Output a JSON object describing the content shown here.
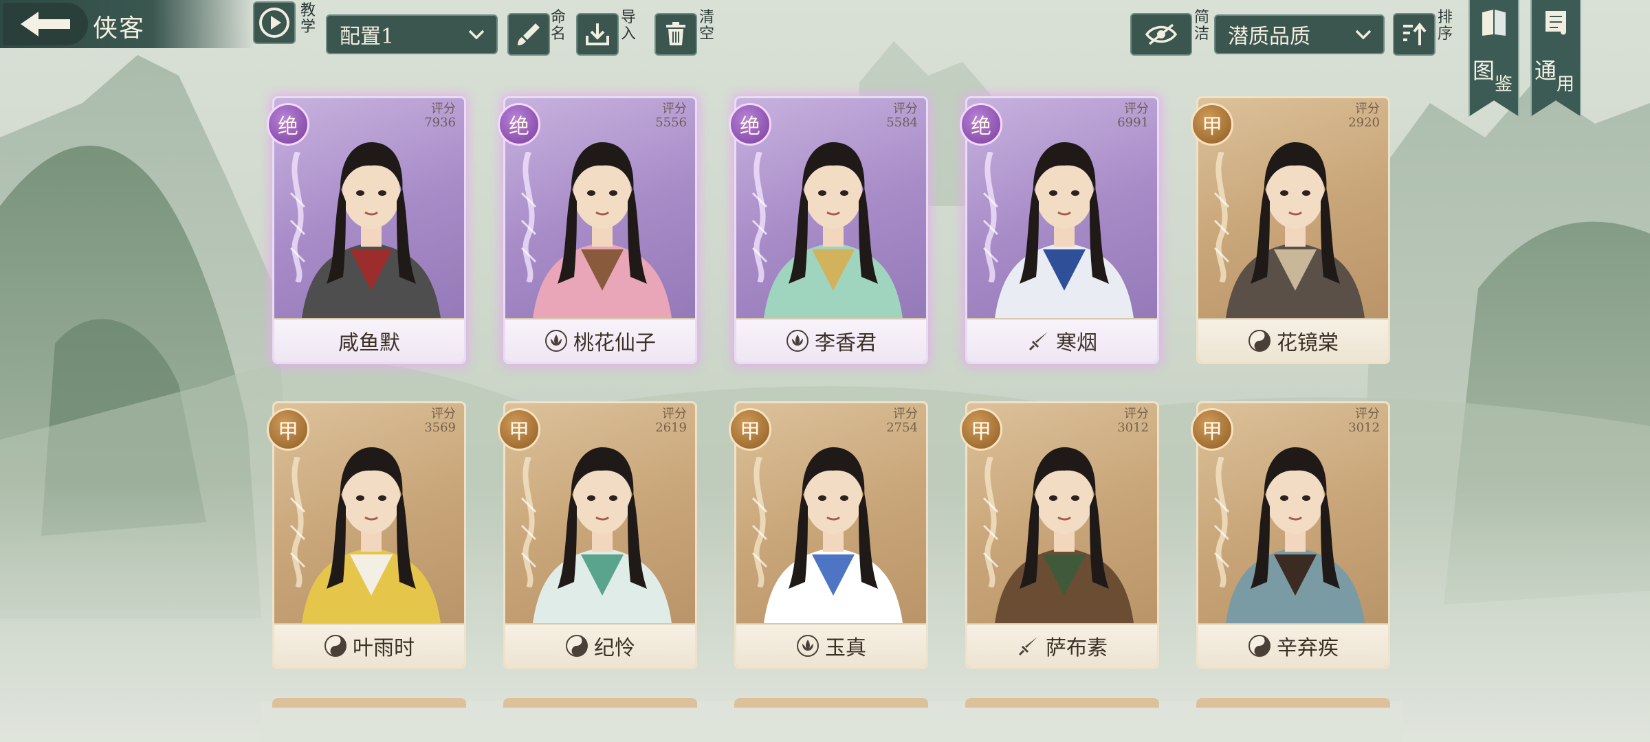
{
  "header": {
    "title": "侠客",
    "tutorial_label": "教学",
    "config_select": "配置1",
    "rename_label": "命名",
    "import_label": "导入",
    "clear_label": "清空",
    "simple_label": "简洁",
    "filter_select": "潜质品质",
    "sort_label": "排序"
  },
  "side_tabs": [
    {
      "label_1": "图",
      "label_2": "鉴"
    },
    {
      "label_1": "通",
      "label_2": "用"
    }
  ],
  "score_label": "评分",
  "cards": [
    {
      "name": "咸鱼默",
      "grade": "绝",
      "score": "7936",
      "tier": "purple",
      "sect_icon": "none",
      "robe": "#4e4e4e",
      "accent": "#9b2d2d"
    },
    {
      "name": "桃花仙子",
      "grade": "绝",
      "score": "5556",
      "tier": "purple",
      "sect_icon": "lotus-icon",
      "robe": "#e8a6b8",
      "accent": "#8a5a3c"
    },
    {
      "name": "李香君",
      "grade": "绝",
      "score": "5584",
      "tier": "purple",
      "sect_icon": "lotus-icon",
      "robe": "#9fd4be",
      "accent": "#d2b25a"
    },
    {
      "name": "寒烟",
      "grade": "绝",
      "score": "6991",
      "tier": "purple",
      "sect_icon": "sword-icon",
      "robe": "#e9edf3",
      "accent": "#2f4f99"
    },
    {
      "name": "花镜棠",
      "grade": "甲",
      "score": "2920",
      "tier": "gold",
      "sect_icon": "yin-yang-icon",
      "robe": "#5a5048",
      "accent": "#c9b79a"
    },
    {
      "name": "叶雨时",
      "grade": "甲",
      "score": "3569",
      "tier": "gold",
      "sect_icon": "yin-yang-icon",
      "robe": "#e6c64a",
      "accent": "#f4efe4"
    },
    {
      "name": "纪怜",
      "grade": "甲",
      "score": "2619",
      "tier": "gold",
      "sect_icon": "yin-yang-icon",
      "robe": "#dfece7",
      "accent": "#5aa38c"
    },
    {
      "name": "玉真",
      "grade": "甲",
      "score": "2754",
      "tier": "gold",
      "sect_icon": "lotus-icon",
      "robe": "#ffffff",
      "accent": "#4d75c4"
    },
    {
      "name": "萨布素",
      "grade": "甲",
      "score": "3012",
      "tier": "gold",
      "sect_icon": "sword-icon",
      "robe": "#6b4d33",
      "accent": "#3f5a3a"
    },
    {
      "name": "辛弃疾",
      "grade": "甲",
      "score": "3012",
      "tier": "gold",
      "sect_icon": "yin-yang-icon",
      "robe": "#7a9ba3",
      "accent": "#3b2b22"
    }
  ]
}
